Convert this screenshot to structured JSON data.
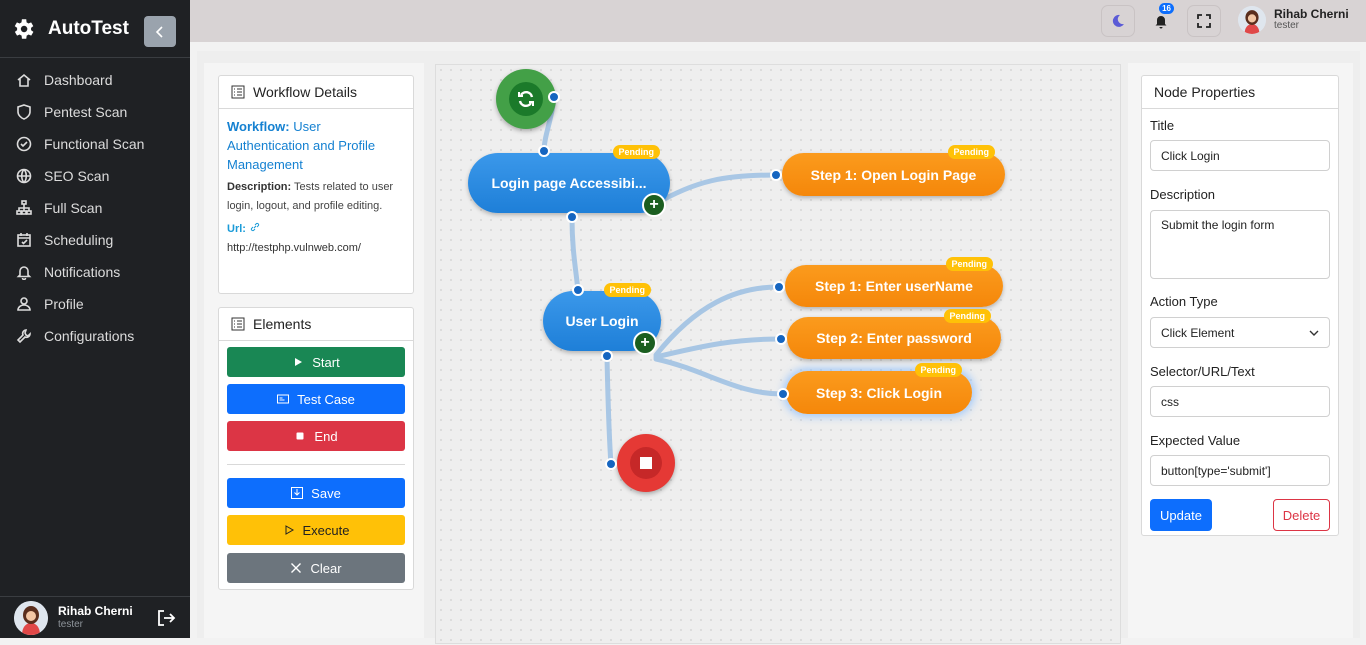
{
  "app": {
    "name": "AutoTest"
  },
  "sidebar": {
    "items": [
      {
        "label": "Dashboard",
        "icon": "home-icon"
      },
      {
        "label": "Pentest Scan",
        "icon": "shield-icon"
      },
      {
        "label": "Functional Scan",
        "icon": "check-circle-icon"
      },
      {
        "label": "SEO Scan",
        "icon": "globe-icon"
      },
      {
        "label": "Full Scan",
        "icon": "sitemap-icon"
      },
      {
        "label": "Scheduling",
        "icon": "calendar-icon"
      },
      {
        "label": "Notifications",
        "icon": "bell-icon"
      },
      {
        "label": "Profile",
        "icon": "user-icon"
      },
      {
        "label": "Configurations",
        "icon": "wrench-icon"
      }
    ]
  },
  "user": {
    "name": "Rihab Cherni",
    "role": "tester"
  },
  "topbar": {
    "notification_count": "16"
  },
  "workflow": {
    "header": "Workflow Details",
    "label": "Workflow:",
    "name": "User Authentication and Profile Management",
    "desc_label": "Description:",
    "description": "Tests related to user login, logout, and profile editing.",
    "url_label": "Url:",
    "url": "http://testphp.vulnweb.com/"
  },
  "elements": {
    "header": "Elements",
    "start": "Start",
    "test_case": "Test Case",
    "end": "End",
    "save": "Save",
    "execute": "Execute",
    "clear": "Clear"
  },
  "flow": {
    "pending_label": "Pending",
    "test_case_1": "Login page Accessibi...",
    "test_case_2": "User Login",
    "step_a1": "Step 1: Open Login Page",
    "step_b1": "Step 1: Enter userName",
    "step_b2": "Step 2: Enter password",
    "step_b3": "Step 3: Click Login"
  },
  "node_properties": {
    "header": "Node Properties",
    "title_label": "Title",
    "title_value": "Click Login",
    "description_label": "Description",
    "description_value": "Submit the login form",
    "action_label": "Action Type",
    "action_value": "Click Element",
    "selector_label": "Selector/URL/Text",
    "selector_value": "css",
    "expected_label": "Expected Value",
    "expected_value": "button[type='submit']",
    "update": "Update",
    "delete": "Delete"
  },
  "colors": {
    "sidebar_bg": "#1f2124",
    "start_green": "#43a047",
    "end_red": "#e53935",
    "test_case_blue": "#1e7fd8",
    "step_orange": "#f5870a",
    "pending_yellow": "#ffc107",
    "primary": "#0d6efd",
    "success": "#198754",
    "danger": "#dc3545",
    "warning": "#ffc107",
    "secondary": "#6c757d"
  }
}
